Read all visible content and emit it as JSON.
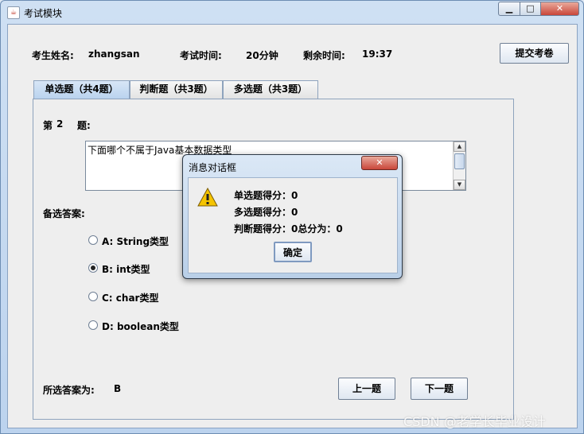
{
  "window": {
    "title": "考试模块",
    "controls": {
      "minimize": "▁",
      "maximize": "□",
      "close": "✕"
    }
  },
  "info": {
    "student_label": "考生姓名:",
    "student_name": "zhangsan",
    "time_label": "考试时间:",
    "time_value": "20分钟",
    "remaining_label": "剩余时间:",
    "remaining_value": "19:37",
    "submit_label": "提交考卷"
  },
  "tabs": [
    {
      "label": "单选题（共4题）",
      "active": true
    },
    {
      "label": "判断题（共3题）",
      "active": false
    },
    {
      "label": "多选题（共3题）",
      "active": false
    }
  ],
  "question": {
    "prefix": "第",
    "number": "2",
    "suffix": "题:",
    "text": "下面哪个不属于Java基本数据类型",
    "options_label": "备选答案:",
    "options": [
      {
        "label": "A: String类型",
        "checked": false
      },
      {
        "label": "B: int类型",
        "checked": true
      },
      {
        "label": "C: char类型",
        "checked": false
      },
      {
        "label": "D: boolean类型",
        "checked": false
      }
    ],
    "selected_label": "所选答案为:",
    "selected_value": "B",
    "prev_label": "上一题",
    "next_label": "下一题"
  },
  "dialog": {
    "title": "消息对话框",
    "lines": [
      "单选题得分：0",
      "多选题得分：0",
      "判断题得分：0总分为：0"
    ],
    "ok_label": "确定",
    "icon": "warning-icon"
  },
  "watermark": "CSDN @老学长毕业设计",
  "colors": {
    "accent": "#b8d2ee",
    "close": "#c9473a",
    "warning": "#f5c400"
  }
}
